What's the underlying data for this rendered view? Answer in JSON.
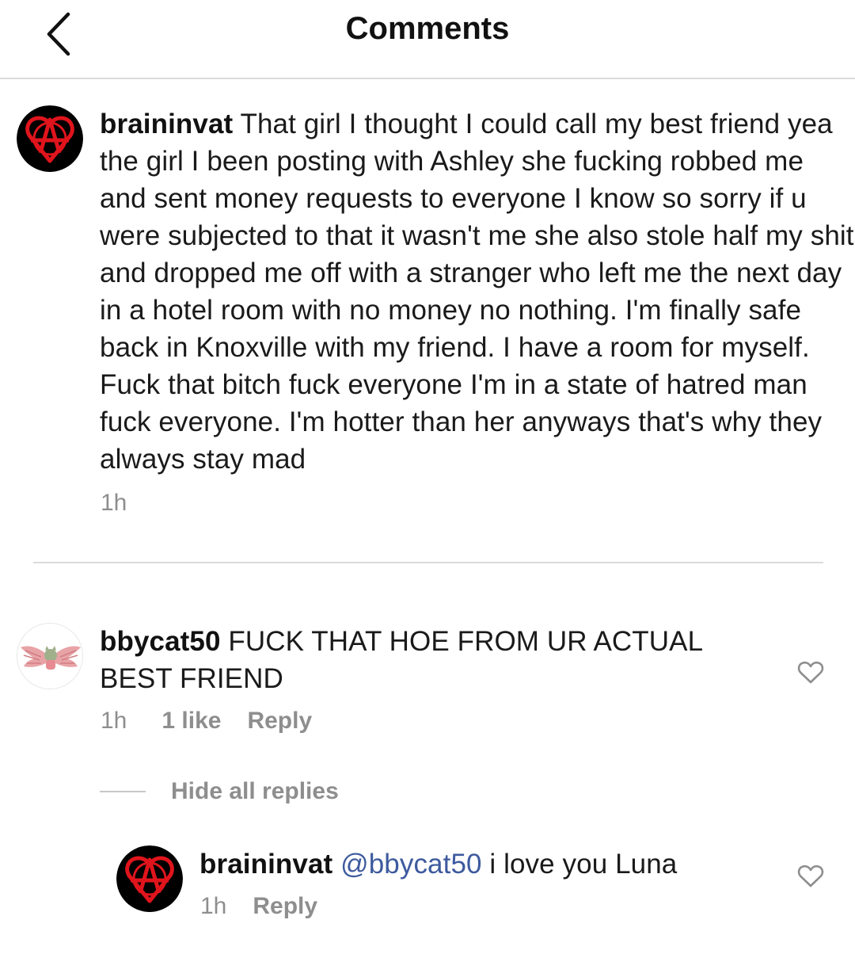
{
  "header": {
    "title": "Comments",
    "back_icon": "chevron-left-icon"
  },
  "comments": [
    {
      "username": "braininvat",
      "text": "That girl I thought I could call my best friend yea the girl I been posting with Ashley she fucking robbed me and sent money requests to everyone I know so sorry if u were subjected to that it wasn't me she also stole half my shit and dropped me off with a stranger who left me the next day in a hotel room with no money no nothing. I'm finally safe back in Knoxville with my friend. I have a room for myself. Fuck that bitch fuck everyone I'm in a state of hatred man fuck everyone. I'm hotter than her anyways that's why they always stay mad",
      "time": "1h",
      "avatar_icon": "red-anarchy-heart-icon"
    },
    {
      "username": "bbycat50",
      "text": "FUCK THAT HOE FROM UR ACTUAL BEST FRIEND",
      "time": "1h",
      "likes": "1 like",
      "reply_label": "Reply",
      "avatar_icon": "winged-cat-icon"
    }
  ],
  "replies_toggle": "Hide all replies",
  "reply": {
    "username": "braininvat",
    "mention": "@bbycat50",
    "text": "i love you Luna",
    "time": "1h",
    "reply_label": "Reply",
    "avatar_icon": "red-anarchy-heart-icon"
  },
  "colors": {
    "mention": "#3d5a9e",
    "meta_gray": "#8e8e8e",
    "divider": "#dbdbdb",
    "avatar_red": "#e0141c"
  }
}
